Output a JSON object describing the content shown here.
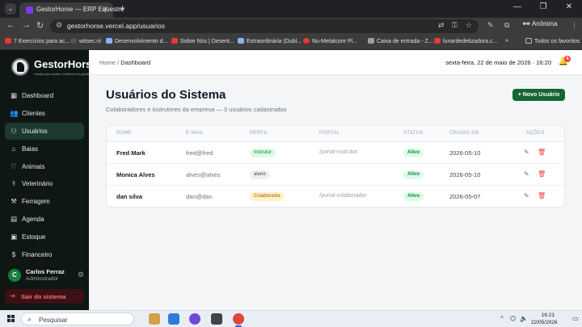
{
  "browser": {
    "tab_title": "GestorHorse — ERP Equestre",
    "url": "gestorhorse.vercel.app/usuarios",
    "profile_label": "Anônima",
    "bookmarks": [
      "7 Exercícios para ac...",
      "witsec.nl",
      "Desenvolvimento d...",
      "Sobre Nós | Desent...",
      "Extraordinária (Dubl...",
      "Nu-Metalcore Pl...",
      "Caixa de entrada - Z...",
      "lunardedetizadora.c..."
    ],
    "bookmarks_more": "»",
    "all_favorites": "Todos os favoritos"
  },
  "sidebar": {
    "brand": "GestorHorse",
    "tagline": "Gestão para cavalos, excelência em gestão.",
    "items": [
      {
        "label": "Dashboard",
        "icon": "grid-icon",
        "glyph": "▦"
      },
      {
        "label": "Clientes",
        "icon": "users-icon",
        "glyph": "👥"
      },
      {
        "label": "Usuários",
        "icon": "user-cog-icon",
        "glyph": "⚇"
      },
      {
        "label": "Baias",
        "icon": "stable-icon",
        "glyph": "⌂"
      },
      {
        "label": "Animais",
        "icon": "heart-icon",
        "glyph": "♡"
      },
      {
        "label": "Veterinário",
        "icon": "stethoscope-icon",
        "glyph": "⚕"
      },
      {
        "label": "Ferragem",
        "icon": "hammer-icon",
        "glyph": "⚒"
      },
      {
        "label": "Agenda",
        "icon": "calendar-icon",
        "glyph": "▤"
      },
      {
        "label": "Estoque",
        "icon": "box-icon",
        "glyph": "▣"
      },
      {
        "label": "Financeiro",
        "icon": "dollar-icon",
        "glyph": "$"
      }
    ],
    "active_index": 2,
    "user": {
      "initial": "C",
      "name": "Carlos Ferraz",
      "role": "Administrador"
    },
    "logout": "Sair do sistema"
  },
  "topbar": {
    "breadcrumb_home": "Home",
    "breadcrumb_sep": "/",
    "breadcrumb_current": "Dashboard",
    "date": "sexta-feira, 22 de maio de 2026 · 16:20",
    "notifications": "4"
  },
  "page": {
    "title": "Usuários do Sistema",
    "subtitle": "Colaboradores e instrutores da empresa — 3 usuários cadastrados",
    "new_button": "+ Novo Usuário"
  },
  "table": {
    "headers": [
      "NOME",
      "E-MAIL",
      "PERFIL",
      "PORTAL",
      "STATUS",
      "CRIADO EM",
      "AÇÕES"
    ],
    "rows": [
      {
        "name": "Fred Mark",
        "email": "fred@fred",
        "role": "Instrutor",
        "portal": "/portal-instrutor",
        "status": "Ativo",
        "created": "2026-05-10"
      },
      {
        "name": "Monica Alves",
        "email": "alves@alves",
        "role": "aluno",
        "portal": "",
        "status": "Ativo",
        "created": "2026-05-10"
      },
      {
        "name": "dan silva",
        "email": "dan@dan",
        "role": "Colaborador",
        "portal": "/portal-colaborador",
        "status": "Ativo",
        "created": "2026-05-07"
      }
    ],
    "colors": {
      "instrutor": "#15803d",
      "colaborador": "#b45309",
      "status_ativo": "#15803d",
      "delete": "#ef4444"
    }
  },
  "taskbar": {
    "search_placeholder": "Pesquisar",
    "time": "16:21",
    "date": "22/05/2026"
  }
}
